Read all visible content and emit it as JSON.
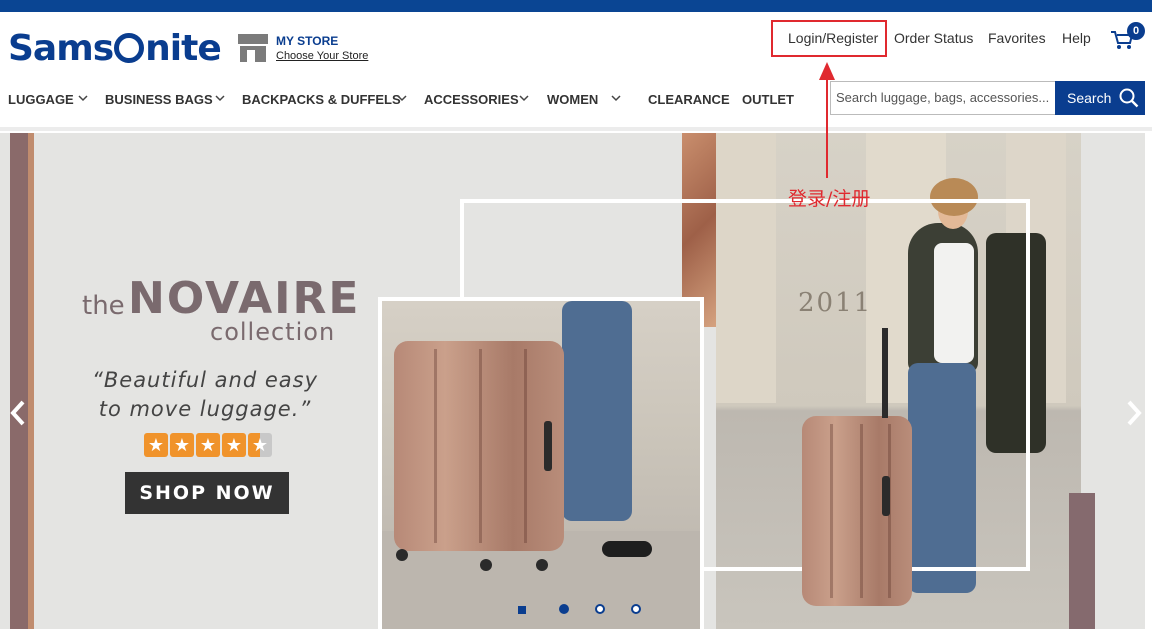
{
  "brand": {
    "logo_text": "Samsonite"
  },
  "store": {
    "title": "MY STORE",
    "link": "Choose Your Store"
  },
  "utility_nav": {
    "login": "Login/Register",
    "order_status": "Order Status",
    "favorites": "Favorites",
    "help": "Help",
    "cart_count": "0"
  },
  "main_nav": [
    {
      "label": "LUGGAGE",
      "has_dropdown": true
    },
    {
      "label": "BUSINESS BAGS",
      "has_dropdown": true
    },
    {
      "label": "BACKPACKS & DUFFELS",
      "has_dropdown": true
    },
    {
      "label": "ACCESSORIES",
      "has_dropdown": true
    },
    {
      "label": "WOMEN",
      "has_dropdown": true
    },
    {
      "label": "CLEARANCE",
      "has_dropdown": false
    },
    {
      "label": "OUTLET",
      "has_dropdown": false
    }
  ],
  "search": {
    "placeholder": "Search luggage, bags, accessories...",
    "button": "Search"
  },
  "hero": {
    "title_prefix": "the",
    "title_main": "NOVAIRE",
    "title_suffix": "collection",
    "quote_line1": "“Beautiful and easy",
    "quote_line2": "to move luggage.”",
    "rating": 4.5,
    "cta": "SHOP NOW",
    "building_number": "2011",
    "carousel": {
      "slides": 4,
      "active": 1
    }
  },
  "annotation": {
    "text": "登录/注册",
    "color": "#e0292f"
  },
  "colors": {
    "brand_blue": "#0a3d8f",
    "accent_red": "#e0292f",
    "star_orange": "#f0932b"
  }
}
